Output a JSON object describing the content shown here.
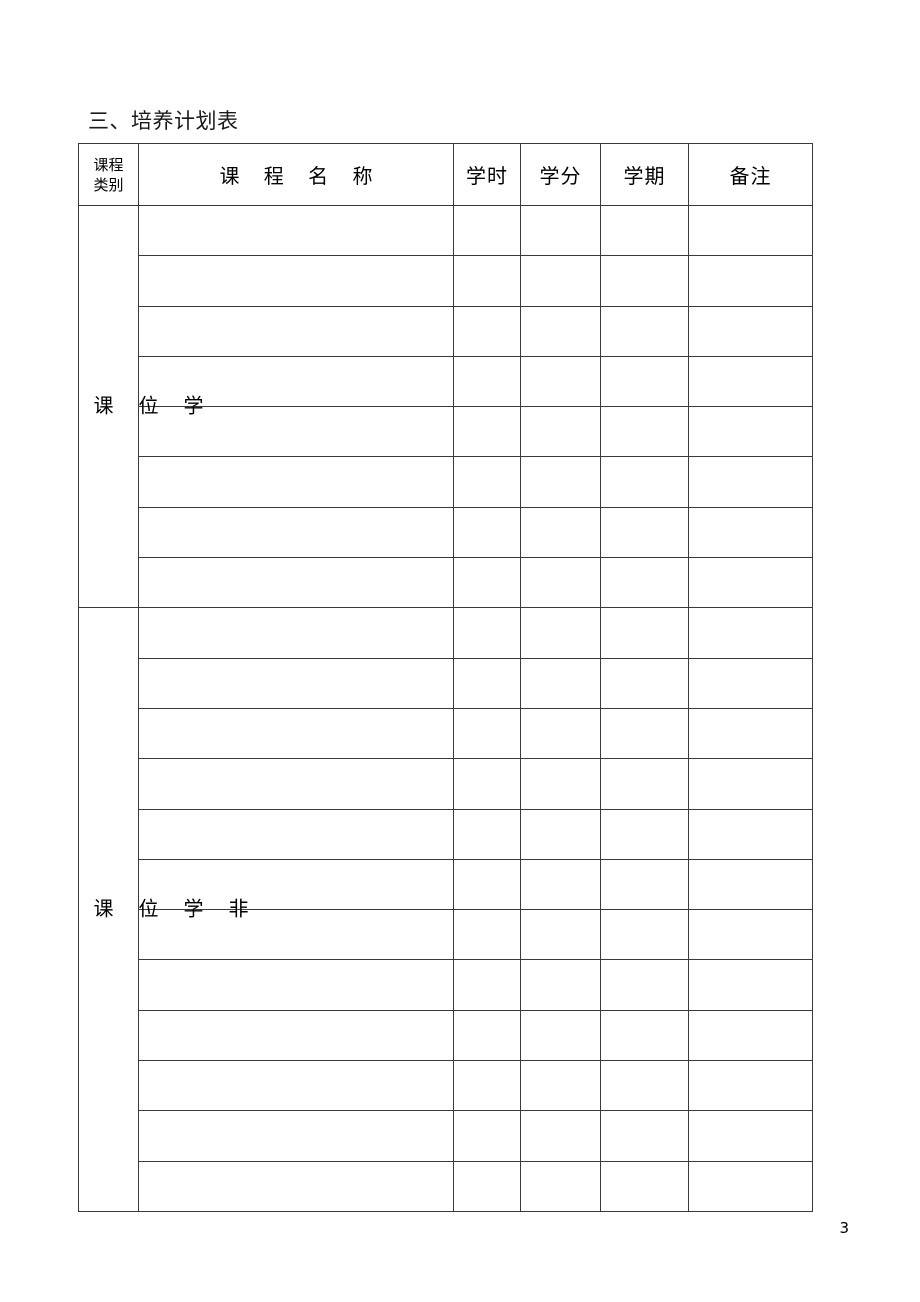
{
  "document": {
    "section_heading": "三、培养计划表",
    "page_number": "3"
  },
  "table": {
    "headers": {
      "category_line1": "课程",
      "category_line2": "类别",
      "course_name": "课 程 名 称",
      "hours": "学时",
      "credits": "学分",
      "term": "学期",
      "remarks": "备注"
    },
    "groups": [
      {
        "label": "学位课",
        "label_chars": [
          "学",
          "位",
          "课"
        ],
        "row_count": 8,
        "rows": [
          {
            "course_name": "",
            "hours": "",
            "credits": "",
            "term": "",
            "remarks": ""
          },
          {
            "course_name": "",
            "hours": "",
            "credits": "",
            "term": "",
            "remarks": ""
          },
          {
            "course_name": "",
            "hours": "",
            "credits": "",
            "term": "",
            "remarks": ""
          },
          {
            "course_name": "",
            "hours": "",
            "credits": "",
            "term": "",
            "remarks": ""
          },
          {
            "course_name": "",
            "hours": "",
            "credits": "",
            "term": "",
            "remarks": ""
          },
          {
            "course_name": "",
            "hours": "",
            "credits": "",
            "term": "",
            "remarks": ""
          },
          {
            "course_name": "",
            "hours": "",
            "credits": "",
            "term": "",
            "remarks": ""
          },
          {
            "course_name": "",
            "hours": "",
            "credits": "",
            "term": "",
            "remarks": ""
          }
        ]
      },
      {
        "label": "非学位课",
        "label_chars": [
          "非",
          "学",
          "位",
          "课"
        ],
        "row_count": 12,
        "rows": [
          {
            "course_name": "",
            "hours": "",
            "credits": "",
            "term": "",
            "remarks": ""
          },
          {
            "course_name": "",
            "hours": "",
            "credits": "",
            "term": "",
            "remarks": ""
          },
          {
            "course_name": "",
            "hours": "",
            "credits": "",
            "term": "",
            "remarks": ""
          },
          {
            "course_name": "",
            "hours": "",
            "credits": "",
            "term": "",
            "remarks": ""
          },
          {
            "course_name": "",
            "hours": "",
            "credits": "",
            "term": "",
            "remarks": ""
          },
          {
            "course_name": "",
            "hours": "",
            "credits": "",
            "term": "",
            "remarks": ""
          },
          {
            "course_name": "",
            "hours": "",
            "credits": "",
            "term": "",
            "remarks": ""
          },
          {
            "course_name": "",
            "hours": "",
            "credits": "",
            "term": "",
            "remarks": ""
          },
          {
            "course_name": "",
            "hours": "",
            "credits": "",
            "term": "",
            "remarks": ""
          },
          {
            "course_name": "",
            "hours": "",
            "credits": "",
            "term": "",
            "remarks": ""
          },
          {
            "course_name": "",
            "hours": "",
            "credits": "",
            "term": "",
            "remarks": ""
          },
          {
            "course_name": "",
            "hours": "",
            "credits": "",
            "term": "",
            "remarks": ""
          }
        ]
      }
    ]
  }
}
